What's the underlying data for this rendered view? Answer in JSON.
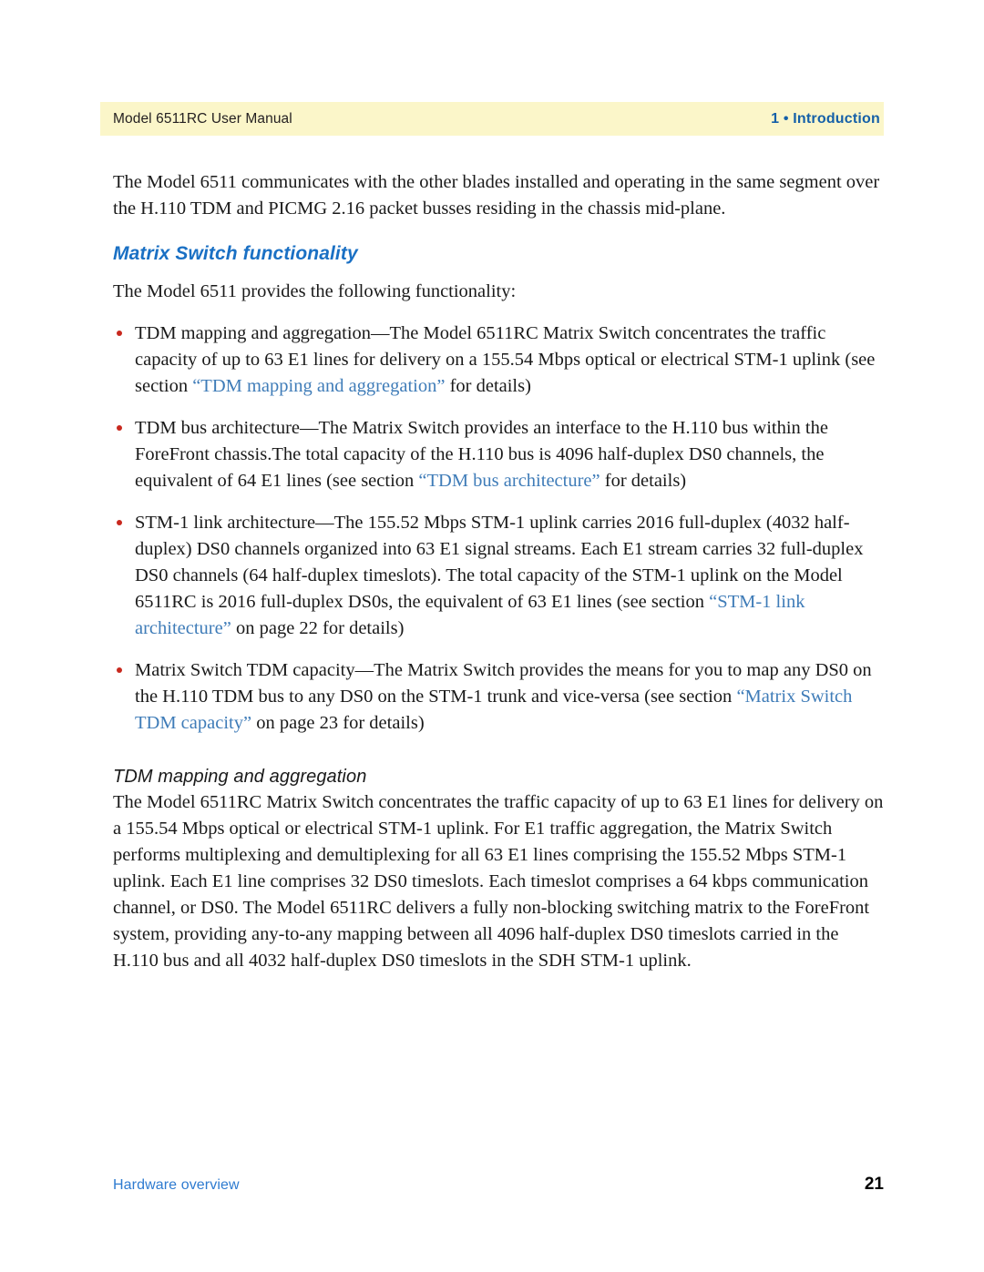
{
  "header": {
    "manual_title": "Model 6511RC User Manual",
    "chapter_label": "1 • Introduction",
    "band_color": "#fbf6c9",
    "chapter_color": "#1560a8"
  },
  "intro_paragraph": "The Model 6511 communicates with the other blades installed and operating in the same segment over the H.110 TDM and PICMG 2.16 packet busses residing in the chassis mid-plane.",
  "section": {
    "heading": "Matrix Switch functionality",
    "heading_color": "#1a70c4",
    "lead_in": "The Model 6511 provides the following functionality:",
    "bullets": [
      {
        "part1": "TDM mapping and aggregation—The Model 6511RC Matrix Switch concentrates the traffic capacity of up to 63 E1 lines for delivery on a 155.54 Mbps optical or electrical STM-1 uplink (see section ",
        "xref": "“TDM mapping and aggregation”",
        "part2": " for details)"
      },
      {
        "part1": "TDM bus architecture—The Matrix Switch provides an interface to the H.110 bus within the ForeFront chassis.The total capacity of the H.110 bus is 4096 half-duplex DS0 channels, the equivalent of 64 E1 lines (see section ",
        "xref": "“TDM bus architecture”",
        "part2": " for details)"
      },
      {
        "part1": "STM-1 link architecture—The 155.52 Mbps STM-1 uplink carries 2016 full-duplex (4032 half-duplex) DS0 channels organized into 63 E1 signal streams. Each E1 stream carries 32 full-duplex DS0 channels (64 half-duplex timeslots). The total capacity of the STM-1 uplink on the Model 6511RC is 2016 full-duplex DS0s, the equivalent of 63 E1 lines (see section ",
        "xref": "“STM-1 link architecture”",
        "part2": " on page 22 for details)"
      },
      {
        "part1": "Matrix Switch TDM capacity—The Matrix Switch provides the means for you to map any DS0 on the H.110 TDM bus to any DS0 on the STM-1 trunk and vice-versa (see section ",
        "xref": "“Matrix Switch TDM capacity”",
        "part2": " on page 23 for details)"
      }
    ],
    "bullet_color": "#c8281e",
    "xref_color": "#3f7cb8"
  },
  "subsection": {
    "heading": "TDM mapping and aggregation",
    "paragraph": "The Model 6511RC Matrix Switch concentrates the traffic capacity of up to 63 E1 lines for delivery on a 155.54 Mbps optical or electrical STM-1 uplink. For E1 traffic aggregation, the Matrix Switch performs multiplexing and demultiplexing for all 63 E1 lines comprising the 155.52 Mbps STM-1 uplink. Each E1 line comprises 32 DS0 timeslots. Each timeslot comprises a 64 kbps communication channel, or DS0. The Model 6511RC delivers a fully non-blocking switching matrix to the ForeFront system, providing any-to-any mapping between all 4096 half-duplex DS0 timeslots carried in the H.110 bus and all 4032 half-duplex DS0 timeslots in the SDH STM-1 uplink."
  },
  "footer": {
    "label": "Hardware overview",
    "page_number": "21",
    "label_color": "#2e7bd0"
  }
}
